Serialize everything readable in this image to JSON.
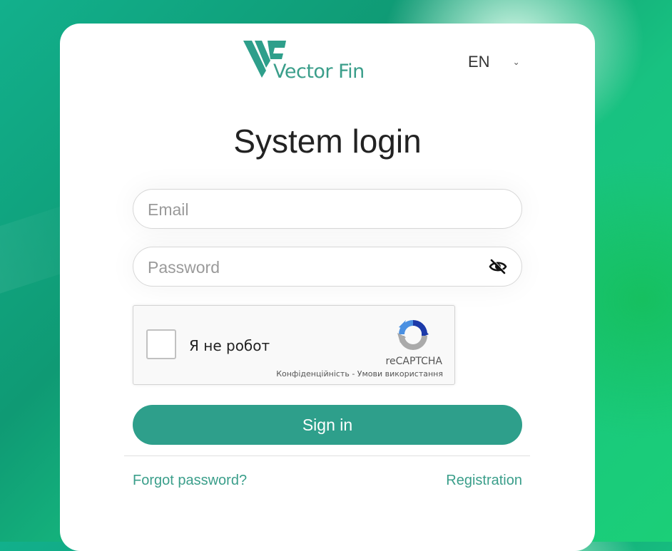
{
  "brand": {
    "logo_text": "Vector Fin",
    "accent": "#3a9e8a"
  },
  "language": {
    "selected": "EN",
    "icon": "chevron-down-icon"
  },
  "page": {
    "title": "System login"
  },
  "form": {
    "email_placeholder": "Email",
    "password_placeholder": "Password",
    "password_toggle_icon": "eye-off-icon",
    "signin_label": "Sign in",
    "signin_color": "#2e9f8b"
  },
  "captcha": {
    "label": "Я не робот",
    "brand": "reCAPTCHA",
    "privacy": "Конфіденційність",
    "separator": " - ",
    "terms": "Умови використання"
  },
  "links": {
    "forgot": "Forgot password?",
    "register": "Registration"
  }
}
